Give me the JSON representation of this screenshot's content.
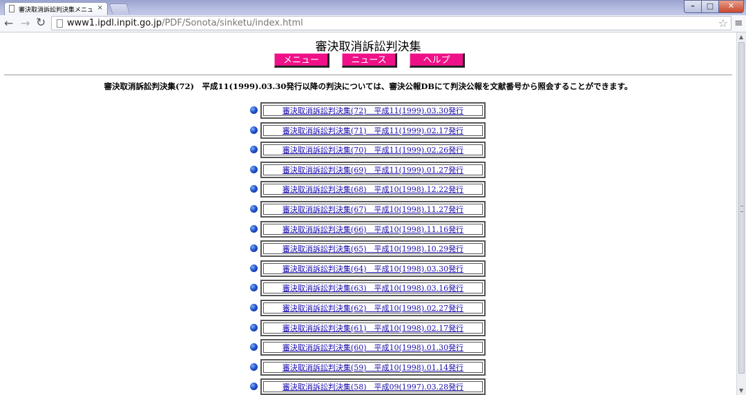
{
  "browser": {
    "tab_title": "審決取消訴訟判決集メニュ",
    "tab_close": "×",
    "url_host": "www1.ipdl.inpit.go.jp",
    "url_path": "/PDF/Sonota/sinketu/index.html",
    "icons": {
      "back": "arrow-left-icon",
      "forward": "arrow-right-icon",
      "reload": "reload-icon",
      "bookmark": "star-icon",
      "menu": "hamburger-menu-icon"
    }
  },
  "page": {
    "title": "審決取消訴訟判決集",
    "buttons": {
      "menu": "メニュー",
      "news": "ニュース",
      "help": "ヘルプ"
    },
    "button_color": "#ee1188",
    "notice": "審決取消訴訟判決集(72)　平成11(1999).03.30発行以降の判決については、審決公報DBにて判決公報を文献番号から照会することができます。"
  },
  "documents": [
    {
      "label": "審決取消訴訟判決集(72)　平成11(1999).03.30発行"
    },
    {
      "label": "審決取消訴訟判決集(71)　平成11(1999).02.17発行"
    },
    {
      "label": "審決取消訴訟判決集(70)　平成11(1999).02.26発行"
    },
    {
      "label": "審決取消訴訟判決集(69)　平成11(1999).01.27発行"
    },
    {
      "label": "審決取消訴訟判決集(68)　平成10(1998).12.22発行"
    },
    {
      "label": "審決取消訴訟判決集(67)　平成10(1998).11.27発行"
    },
    {
      "label": "審決取消訴訟判決集(66)　平成10(1998).11.16発行"
    },
    {
      "label": "審決取消訴訟判決集(65)　平成10(1998).10.29発行"
    },
    {
      "label": "審決取消訴訟判決集(64)　平成10(1998).03.30発行"
    },
    {
      "label": "審決取消訴訟判決集(63)　平成10(1998).03.16発行"
    },
    {
      "label": "審決取消訴訟判決集(62)　平成10(1998).02.27発行"
    },
    {
      "label": "審決取消訴訟判決集(61)　平成10(1998).02.17発行"
    },
    {
      "label": "審決取消訴訟判決集(60)　平成10(1998).01.30発行"
    },
    {
      "label": "審決取消訴訟判決集(59)　平成10(1998).01.14発行"
    },
    {
      "label": "審決取消訴訟判決集(58)　平成09(1997).03.28発行"
    }
  ]
}
